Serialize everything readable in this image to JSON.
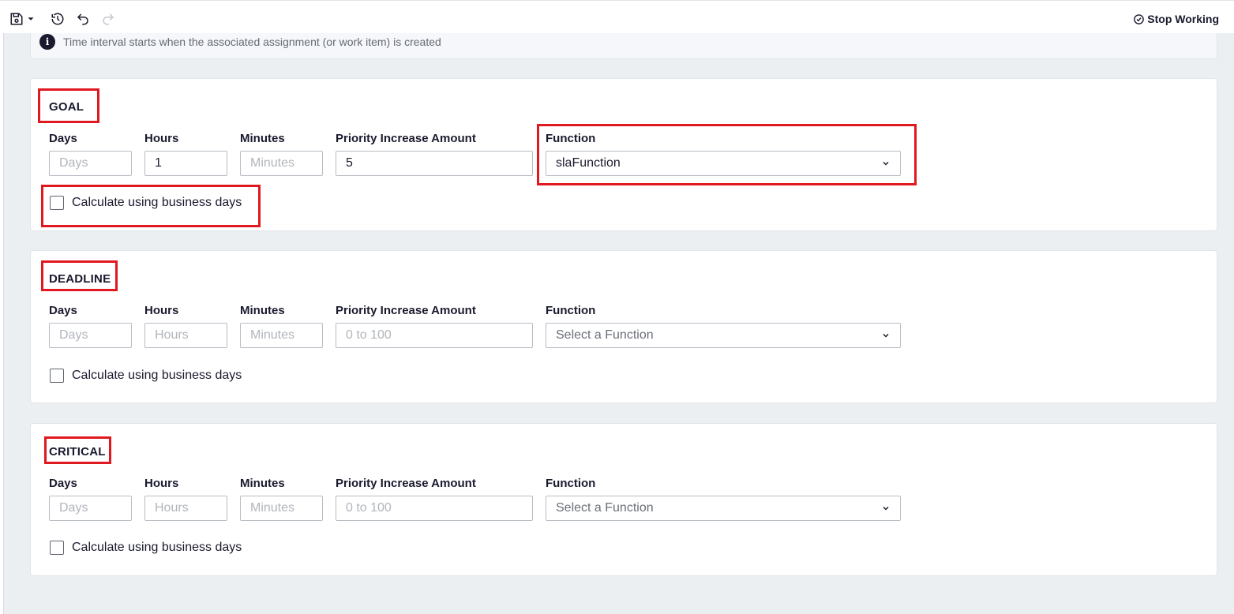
{
  "toolbar": {
    "icons": [
      "save-icon",
      "dropdown-caret-icon",
      "history-icon",
      "undo-icon",
      "redo-icon"
    ],
    "stop_working_label": "Stop Working"
  },
  "info": {
    "icon": "info-icon",
    "glyph": "i",
    "text": "Time interval starts when the associated assignment (or work item) is created"
  },
  "labels": {
    "days": "Days",
    "hours": "Hours",
    "minutes": "Minutes",
    "priority": "Priority Increase Amount",
    "function": "Function",
    "business_days": "Calculate using business days"
  },
  "placeholders": {
    "days": "Days",
    "hours": "Hours",
    "minutes": "Minutes",
    "priority": "0 to 100",
    "function": "Select a Function"
  },
  "sections": {
    "goal": {
      "title": "GOAL",
      "days": "",
      "hours": "1",
      "minutes": "",
      "priority": "5",
      "function": "slaFunction",
      "business_days_checked": false
    },
    "deadline": {
      "title": "DEADLINE",
      "days": "",
      "hours": "",
      "minutes": "",
      "priority": "",
      "function": "",
      "business_days_checked": false
    },
    "critical": {
      "title": "CRITICAL",
      "days": "",
      "hours": "",
      "minutes": "",
      "priority": "",
      "function": "",
      "business_days_checked": false
    }
  },
  "colors": {
    "highlight": "#e0181f",
    "background": "#eceff2",
    "text": "#1a1a2e"
  }
}
